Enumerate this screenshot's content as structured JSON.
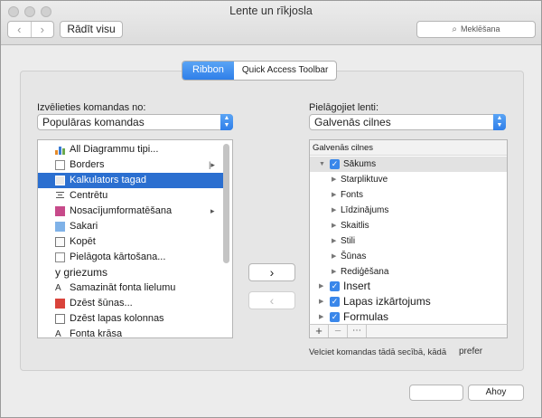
{
  "window": {
    "title": "Lente un rīkjosla"
  },
  "toolbar": {
    "back_icon": "‹",
    "forward_icon": "›",
    "show_all": "Rādīt visu",
    "search_placeholder": "Meklēšana"
  },
  "tabs": [
    {
      "label": "Ribbon",
      "active": true
    },
    {
      "label": "Quick Access Toolbar",
      "active": false
    }
  ],
  "left": {
    "label": "Izvēlieties komandas no:",
    "select_value": "Populāras komandas",
    "items": [
      {
        "label": "All Diagrammu tipi...",
        "icon": "chart-icon",
        "submenu": ""
      },
      {
        "label": "Borders",
        "icon": "borders-icon",
        "submenu": "|▸"
      },
      {
        "label": "Kalkulators tagad",
        "icon": "calculator-icon",
        "submenu": "",
        "selected": true
      },
      {
        "label": "Centrētu",
        "icon": "center-icon",
        "submenu": ""
      },
      {
        "label": "Nosacījumformatēšana",
        "icon": "conditional-format-icon",
        "submenu": "▸"
      },
      {
        "label": "Sakari",
        "icon": "connect-icon",
        "submenu": ""
      },
      {
        "label": "Kopēt",
        "icon": "copy-icon",
        "submenu": ""
      },
      {
        "label": "Pielāgota kārtošana...",
        "icon": "sort-icon",
        "submenu": ""
      },
      {
        "label": "y griezums",
        "icon": "",
        "submenu": ""
      },
      {
        "label": "Samazināt fonta lielumu",
        "icon": "decrease-font-icon",
        "submenu": ""
      },
      {
        "label": "Dzēst šūnas...",
        "icon": "delete-cells-icon",
        "submenu": ""
      },
      {
        "label": "Dzēst lapas kolonnas",
        "icon": "delete-columns-icon",
        "submenu": ""
      },
      {
        "label": "Fonta krāsa",
        "icon": "font-color-icon",
        "submenu": ""
      }
    ]
  },
  "right": {
    "label": "Pielāgojiet lenti:",
    "select_value": "Galvenās cilnes",
    "tree_header": "Galvenās cilnes",
    "tree": [
      {
        "label": "Sākums",
        "level": 0,
        "expanded": true,
        "checked": true,
        "size": 10
      },
      {
        "label": "Starpliktuve",
        "level": 1,
        "size": 10
      },
      {
        "label": "Fonts",
        "level": 1,
        "size": 10
      },
      {
        "label": "Līdzinājums",
        "level": 1,
        "size": 10
      },
      {
        "label": "Skaitlis",
        "level": 1,
        "size": 10
      },
      {
        "label": "Stili",
        "level": 1,
        "size": 10
      },
      {
        "label": "Šūnas",
        "level": 1,
        "size": 10
      },
      {
        "label": "Rediģēšana",
        "level": 1,
        "size": 10
      },
      {
        "label": "Insert",
        "level": 0,
        "checked": true,
        "size": 12
      },
      {
        "label": "Lapas izkārtojums",
        "level": 0,
        "checked": true,
        "size": 12
      },
      {
        "label": "Formulas",
        "level": 0,
        "checked": true,
        "size": 12
      }
    ],
    "footer": {
      "add": "+",
      "remove": "−",
      "more": "⋯"
    },
    "hint": "Velciet komandas tādā secībā, kādā",
    "hint2": "prefer"
  },
  "move": {
    "add": "›",
    "remove": "‹"
  },
  "buttons": {
    "cancel": "",
    "ok": "Ahoy"
  },
  "colors": {
    "accent": "#2f7fe9",
    "selection": "#2b6fd0",
    "checkbox": "#3a87ea"
  }
}
